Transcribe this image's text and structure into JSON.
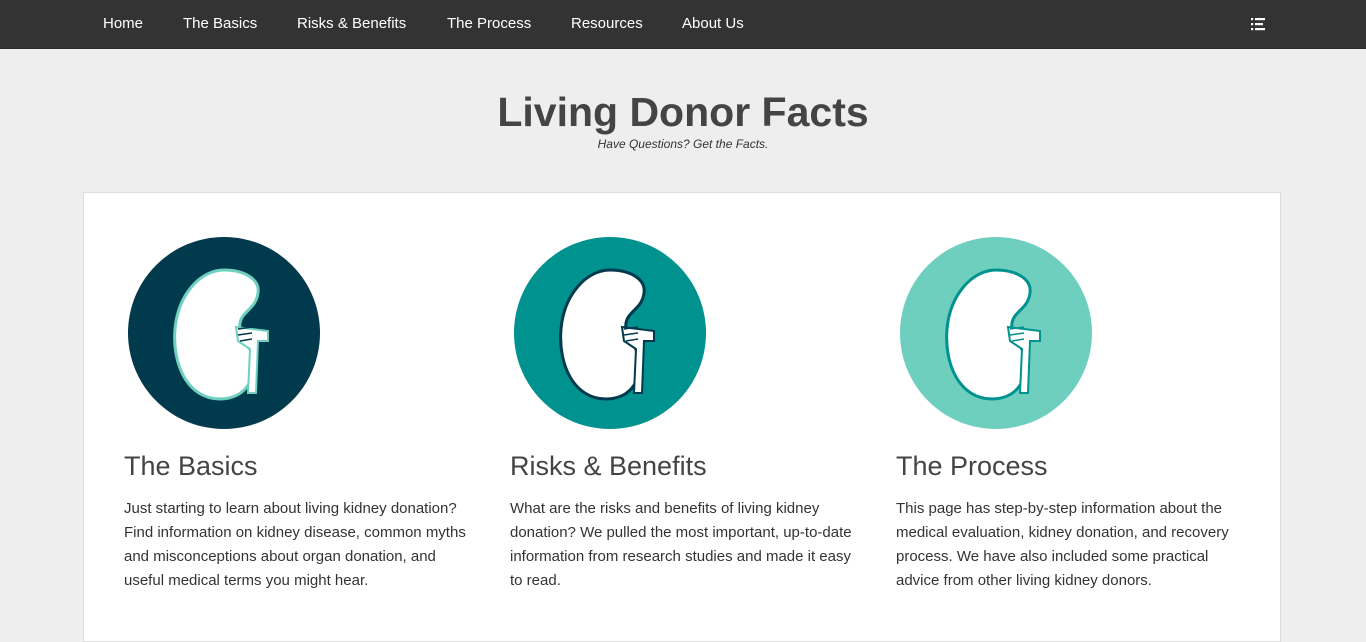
{
  "nav": {
    "items": [
      {
        "label": "Home"
      },
      {
        "label": "The Basics"
      },
      {
        "label": "Risks & Benefits"
      },
      {
        "label": "The Process"
      },
      {
        "label": "Resources"
      },
      {
        "label": "About Us"
      }
    ],
    "menu_icon": "list-menu-icon"
  },
  "header": {
    "title": "Living Donor Facts",
    "tagline": "Have Questions? Get the Facts."
  },
  "cards": [
    {
      "title": "The Basics",
      "description": "Just starting to learn about living kidney donation? Find information on kidney disease, common myths and misconceptions about organ donation, and useful medical terms you might hear.",
      "icon": "kidney-icon",
      "circle_color": "#013a4c",
      "kidney_stroke": "#6fd0bf"
    },
    {
      "title": "Risks & Benefits",
      "description": "What are the risks and benefits of living kidney donation? We pulled the most important, up-to-date information from research studies and made it easy to read.",
      "icon": "kidney-icon",
      "circle_color": "#00928f",
      "kidney_stroke": "#013a4c"
    },
    {
      "title": "The Process",
      "description": "This page has step-by-step information about the medical evaluation, kidney donation, and recovery process. We have also included some practical advice from other living kidney donors.",
      "icon": "kidney-icon",
      "circle_color": "#6fcfbf",
      "kidney_stroke": "#00928f"
    }
  ],
  "colors": {
    "navbar_bg": "#333333",
    "page_bg": "#eeeeee",
    "panel_bg": "#ffffff",
    "heading": "#444444"
  }
}
